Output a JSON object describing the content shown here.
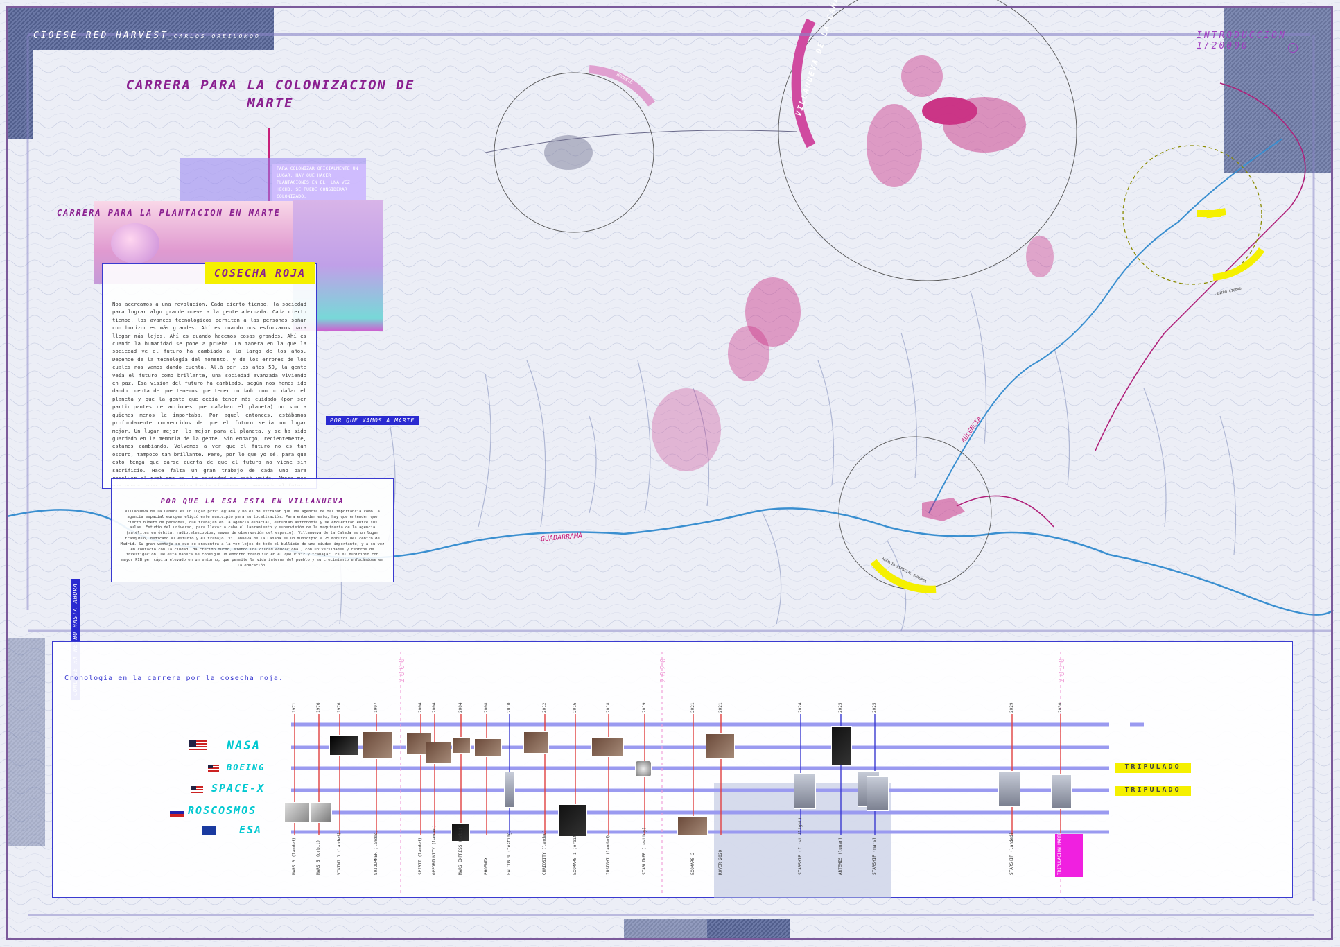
{
  "header": {
    "left": "CIOESE RED HARVEST",
    "left_author": "_CARLOS OREILOMOO",
    "right": "INTRODUCCION 1/20000"
  },
  "titles": {
    "main": "CARRERA PARA LA COLONIZACION DE MARTE",
    "plantacion": "CARRERA PARA LA PLANTACION EN MARTE",
    "cosecha": "COSECHA ROJA",
    "esa_section": "POR QUE LA ESA ESTA EN VILLANUEVA"
  },
  "note": "PARA COLONIZAR OFICIALMENTE UN LUGAR, HAY QUE HACER PLANTACIONES EN EL. UNA VEZ HECHO, SE PUEDE CONSIDERAR COLONIZADO.",
  "cosecha_text": "Nos acercamos a una revolución. Cada cierto tiempo, la sociedad para lograr algo grande mueve a la gente adecuada. Cada cierto tiempo, los avances tecnológicos permiten a las personas soñar con horizontes más grandes. Ahí es cuando nos esforzamos para llegar más lejos. Ahí es cuando hacemos cosas grandes. Ahí es cuando la humanidad se pone a prueba. La manera en la que la sociedad ve el futuro ha cambiado a lo largo de los años. Depende de la tecnología del momento, y de los errores de los cuales nos vamos dando cuenta. Allá por los años 50, la gente veía el futuro como brillante, una sociedad avanzada viviendo en paz. Esa visión del futuro ha cambiado, según nos hemos ido dando cuenta de que tenemos que tener cuidado con no dañar el planeta y que la gente que debía tener más cuidado (por ser participantes de acciones que dañaban el planeta) no son a quienes menos le importaba. Por aquel entonces, estábamos profundamente convencidos de que el futuro sería un lugar mejor. Un lugar mejor, lo mejor para el planeta, y se ha sido guardado en la memoria de la gente. Sin embargo, recientemente, estamos cambiando. Volvemos a ver que el futuro no es tan oscuro, tampoco tan brillante. Pero, por lo que yo sé, para que esto tenga que darse cuenta de que el futuro no viene sin sacrificio. Hace falta un gran trabajo de cada uno para resolver el problema es. La sociedad no está unida. Ahora más que nunca, unas veces mira hacia sí misma, y pensando el futuro de personas por trabajo. Solamente, en un gran deseo como una misión nos ponemos a trabajar todos juntos en una dirección. Solamente así avanzamos, en la misma dirección alcanzaremos nuestros objetivos. Y esa dirección es hacia arriba.",
  "esa_text": "Villanueva de la Cañada es un lugar privilegiado y no es de extrañar que una agencia de tal importancia como la agencia espacial europea eligió este municipio para su localización. Para entender esto, hay que entender que cierto número de personas, que trabajan en la agencia espacial, estudian astronomía y se encuentran entre sus aulas. Estudio del universo, para llevar a cabo el lanzamiento y supervisión de la maquinaria de la agencia (satélites en órbita, radiotelescopios, naves de observación del espacio). Villanueva de la Cañada es un lugar tranquilo, dedicado al estudio y el trabajo. Villanueva de la Cañada es un municipio a 25 minutos del centro de Madrid. Su gran ventaja es que se encuentra a la vez lejos de todo el bullicio de una ciudad importante, y a su vez en contacto con la ciudad. Ha crecido mucho, siendo una ciudad educacional, con universidades y centros de investigación. De esta manera se consigue un entorno tranquilo en el que vivir y trabajar. Es el municipio con mayor PIB per cápita elevado en un entorno, que permite la vida interna del pueblo y su crecimiento enfocándose en la educación.",
  "tags": {
    "porque_marte": "POR QUE VAMOS A MARTE",
    "como_hecho": "COMO SE HA HECHO HASTA AHORA"
  },
  "map_labels": {
    "villanueva": "VILLANUEVA DE LA CAÑADA",
    "brunete": "BRUNETE",
    "guadarrama": "GUADARRAMA",
    "aulencia": "AULENCIA",
    "centro_ciudad": "CENTRO CIUDAD",
    "esa_label": "AGENCIA ESPACIAL EUROPEA"
  },
  "timeline": {
    "title": "Cronología en la carrera por la cosecha roja.",
    "decades": [
      "2000",
      "2020",
      "2030"
    ],
    "agencies": [
      "NASA",
      "BOEING",
      "SPACE-X",
      "ROSCOSMOS",
      "ESA"
    ],
    "tripulado": [
      "TRIPULADO",
      "TRIPULADO"
    ],
    "years": [
      "1971",
      "1976",
      "1976",
      "1997",
      "2004",
      "2004",
      "2004",
      "2008",
      "2010",
      "2012",
      "2016",
      "2018",
      "2019",
      "2021",
      "2021",
      "2024",
      "2025",
      "2025",
      "2029",
      "2030"
    ],
    "missions": [
      "MARS 3 (landed)",
      "MARS 5 (orbit)",
      "VIKING 1 (landed)",
      "SOJOURNER (landed)",
      "SPIRIT (landed)",
      "OPPORTUNITY (landed)",
      "MARS EXPRESS (orbit)",
      "PHOENIX",
      "FALCON 9 (testing)",
      "CURIOSITY (landed)",
      "EXOMARS 1 (orbit)",
      "INSIGHT (landed)",
      "STARLINER (testing)",
      "EXOMARS 2",
      "ROVER 2020",
      "STARSHIP (first flight)",
      "ARTEMIS (lunar)",
      "STARSHIP (mars)",
      "STARSHIP (landed)",
      "TRIPULACION MARTE"
    ]
  },
  "colors": {
    "magenta": "#c8207a",
    "blue": "#3a3ad0",
    "cyan": "#00c8d0",
    "yellow": "#f5f000",
    "purple": "#8a2090"
  }
}
